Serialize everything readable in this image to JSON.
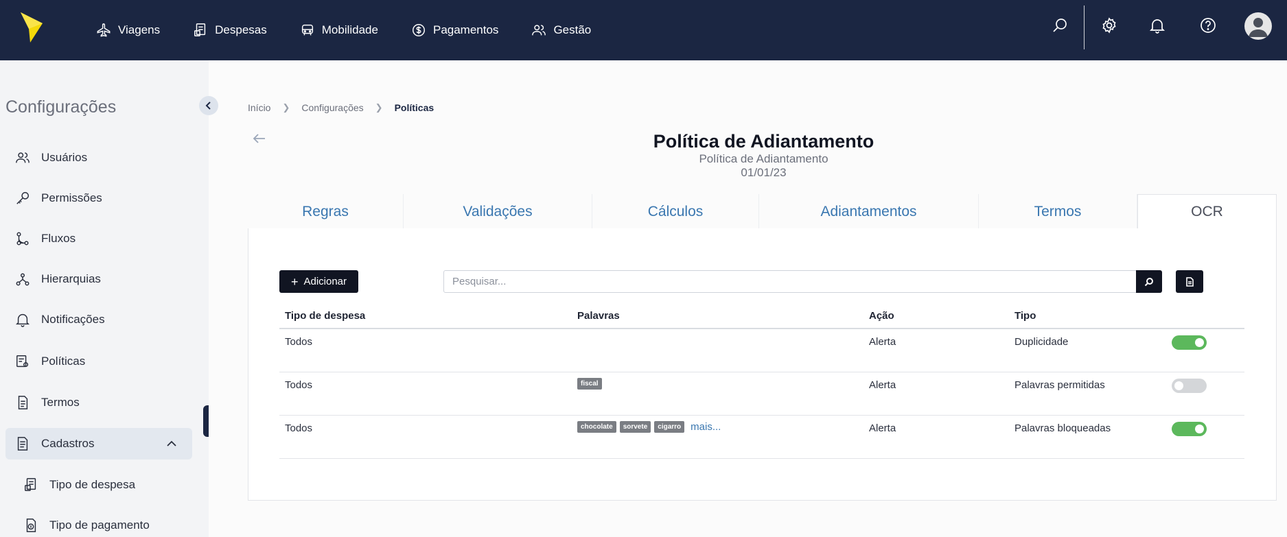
{
  "topnav": {
    "items": [
      {
        "label": "Viagens"
      },
      {
        "label": "Despesas"
      },
      {
        "label": "Mobilidade"
      },
      {
        "label": "Pagamentos"
      },
      {
        "label": "Gestão"
      }
    ],
    "icons": [
      "search-icon",
      "gear-icon",
      "bell-icon",
      "help-icon",
      "avatar"
    ],
    "brand_color": "#1b2642",
    "logo_color": "#f5d90a"
  },
  "sidebar": {
    "title": "Configurações",
    "items": [
      {
        "label": "Usuários",
        "icon": "users-icon"
      },
      {
        "label": "Permissões",
        "icon": "key-icon"
      },
      {
        "label": "Fluxos",
        "icon": "flow-icon"
      },
      {
        "label": "Hierarquias",
        "icon": "hierarchy-icon"
      },
      {
        "label": "Notificações",
        "icon": "bell-icon"
      },
      {
        "label": "Políticas",
        "icon": "policy-icon"
      },
      {
        "label": "Termos",
        "icon": "document-icon"
      },
      {
        "label": "Cadastros",
        "icon": "register-icon",
        "expanded": true
      },
      {
        "label": "Tipo de despesa",
        "icon": "expense-type-icon"
      },
      {
        "label": "Tipo de pagamento",
        "icon": "payment-type-icon"
      }
    ]
  },
  "breadcrumb": [
    "Início",
    "Configurações",
    "Políticas"
  ],
  "page": {
    "title": "Política de Adiantamento",
    "subtitle": "Política de Adiantamento",
    "date": "01/01/23"
  },
  "tabs": [
    {
      "label": "Regras",
      "active": false
    },
    {
      "label": "Validações",
      "active": false
    },
    {
      "label": "Cálculos",
      "active": false
    },
    {
      "label": "Adiantamentos",
      "active": false
    },
    {
      "label": "Termos",
      "active": false
    },
    {
      "label": "OCR",
      "active": true
    }
  ],
  "toolbar": {
    "add_label": "Adicionar",
    "search_placeholder": "Pesquisar..."
  },
  "table": {
    "columns": [
      "Tipo de despesa",
      "Palavras",
      "Ação",
      "Tipo"
    ],
    "rows": [
      {
        "tipo_despesa": "Todos",
        "palavras": [],
        "acao": "Alerta",
        "tipo": "Duplicidade",
        "enabled": true
      },
      {
        "tipo_despesa": "Todos",
        "palavras": [
          "fiscal"
        ],
        "acao": "Alerta",
        "tipo": "Palavras permitidas",
        "enabled": false
      },
      {
        "tipo_despesa": "Todos",
        "palavras": [
          "chocolate",
          "sorvete",
          "cigarro"
        ],
        "more_label": "mais...",
        "acao": "Alerta",
        "tipo": "Palavras bloqueadas",
        "enabled": true
      }
    ]
  },
  "colors": {
    "toggle_on": "#5cb85c",
    "toggle_off": "#d4d6d9",
    "tab_link": "#3a77b0",
    "tag_bg": "#7a7d83"
  }
}
